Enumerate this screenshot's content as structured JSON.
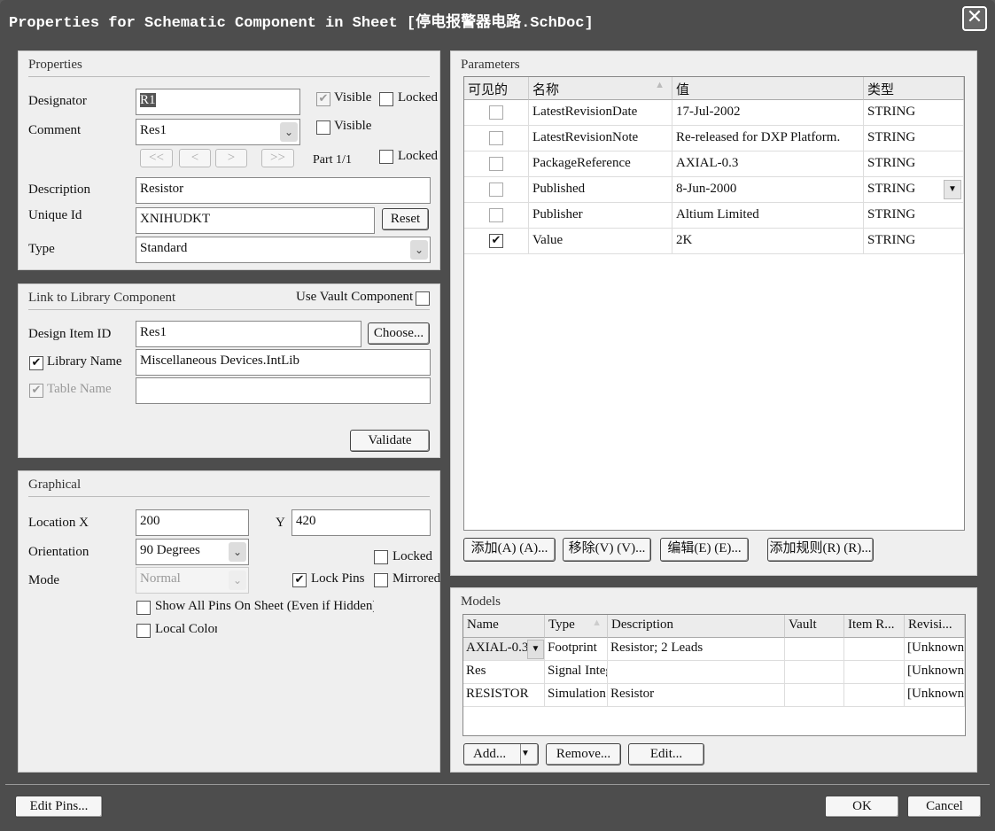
{
  "title": "Properties for Schematic Component in Sheet [停电报警器电路.SchDoc]",
  "properties": {
    "heading": "Properties",
    "designator_label": "Designator",
    "designator_value": "R1",
    "comment_label": "Comment",
    "comment_value": "Res1",
    "visible1": "Visible",
    "visible1_checked": true,
    "locked1": "Locked",
    "visible2": "Visible",
    "part_label": "Part 1/1",
    "locked2": "Locked",
    "nav": [
      "<<",
      "<",
      ">",
      ">>"
    ],
    "description_label": "Description",
    "description_value": "Resistor",
    "unique_id_label": "Unique Id",
    "unique_id_value": "XNIHUDKT",
    "reset": "Reset",
    "type_label": "Type",
    "type_value": "Standard"
  },
  "link": {
    "heading": "Link to Library Component",
    "use_vault": "Use Vault Component",
    "design_item_label": "Design Item ID",
    "design_item_value": "Res1",
    "choose": "Choose...",
    "library_name_label": "Library Name",
    "library_name_value": "Miscellaneous Devices.IntLib",
    "table_name_label": "Table Name",
    "table_name_value": "",
    "validate": "Validate"
  },
  "graphical": {
    "heading": "Graphical",
    "location_label": "Location  X",
    "x_value": "200",
    "y_label": "Y",
    "y_value": "420",
    "orientation_label": "Orientation",
    "orientation_value": "90 Degrees",
    "mode_label": "Mode",
    "mode_value": "Normal",
    "locked": "Locked",
    "lock_pins": "Lock Pins",
    "mirrored": "Mirrored",
    "show_all_pins": "Show All Pins On Sheet (Even if Hidden)",
    "local_colors": "Local Colors"
  },
  "parameters": {
    "heading": "Parameters",
    "columns": [
      "可见的",
      "名称",
      "值",
      "类型"
    ],
    "rows": [
      {
        "visible": false,
        "name": "LatestRevisionDate",
        "value": "17-Jul-2002",
        "type": "STRING"
      },
      {
        "visible": false,
        "name": "LatestRevisionNote",
        "value": "Re-released for DXP Platform.",
        "type": "STRING"
      },
      {
        "visible": false,
        "name": "PackageReference",
        "value": "AXIAL-0.3",
        "type": "STRING"
      },
      {
        "visible": false,
        "name": "Published",
        "value": "8-Jun-2000",
        "type": "STRING"
      },
      {
        "visible": false,
        "name": "Publisher",
        "value": "Altium Limited",
        "type": "STRING"
      },
      {
        "visible": true,
        "name": "Value",
        "value": "2K",
        "type": "STRING"
      }
    ],
    "buttons": [
      "添加(A) (A)...",
      "移除(V) (V)...",
      "编辑(E) (E)...",
      "添加规则(R) (R)..."
    ]
  },
  "models": {
    "heading": "Models",
    "columns": [
      "Name",
      "Type",
      "Description",
      "Vault",
      "Item R...",
      "Revisi..."
    ],
    "rows": [
      {
        "name": "AXIAL-0.3",
        "type": "Footprint",
        "description": "Resistor; 2 Leads",
        "vault": "",
        "item": "",
        "revision": "[Unknown"
      },
      {
        "name": "Res",
        "type": "Signal Integrity",
        "description": "",
        "vault": "",
        "item": "",
        "revision": "[Unknown"
      },
      {
        "name": "RESISTOR",
        "type": "Simulation",
        "description": "Resistor",
        "vault": "",
        "item": "",
        "revision": "[Unknown"
      }
    ],
    "add": "Add...",
    "remove": "Remove...",
    "edit": "Edit..."
  },
  "footer": {
    "edit_pins": "Edit Pins...",
    "ok": "OK",
    "cancel": "Cancel"
  }
}
